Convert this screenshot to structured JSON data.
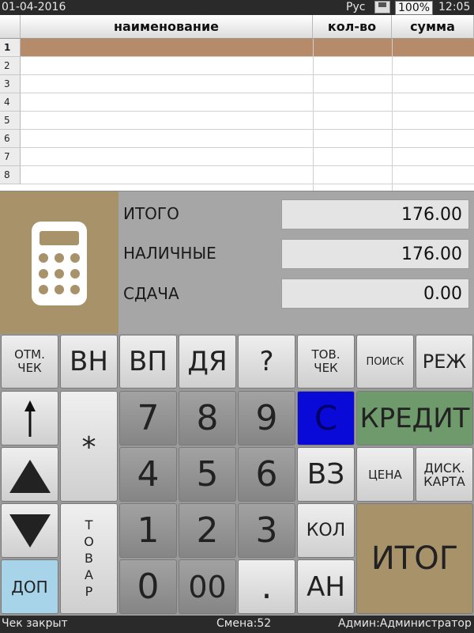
{
  "status": {
    "date": "01-04-2016",
    "lang": "Рус",
    "battery": "100%",
    "time": "12:05"
  },
  "table": {
    "columns": [
      "наименование",
      "кол-во",
      "сумма"
    ],
    "rows": [
      "1",
      "2",
      "3",
      "4",
      "5",
      "6",
      "7",
      "8"
    ]
  },
  "totals": {
    "total_label": "ИТОГО",
    "total_value": "176.00",
    "cash_label": "НАЛИЧНЫЕ",
    "cash_value": "176.00",
    "change_label": "СДАЧА",
    "change_value": "0.00"
  },
  "keys": {
    "cancel_check": "ОТМ. ЧЕК",
    "vn": "ВН",
    "vp": "ВП",
    "dya": "ДЯ",
    "question": "?",
    "goods_check": "ТОВ. ЧЕК",
    "search": "ПОИСК",
    "mode": "РЕЖ",
    "star": "*",
    "n7": "7",
    "n8": "8",
    "n9": "9",
    "clear": "С",
    "credit": "КРЕДИТ",
    "n4": "4",
    "n5": "5",
    "n6": "6",
    "return": "ВЗ",
    "price": "ЦЕНА",
    "disc_card": "ДИСК. КАРТА",
    "goods": "ТОВАР",
    "n1": "1",
    "n2": "2",
    "n3": "3",
    "qty": "КОЛ",
    "itog": "ИТОГ",
    "dop": "ДОП",
    "n0": "0",
    "n00": "00",
    "dot": ".",
    "an": "АН"
  },
  "footer": {
    "check_state": "Чек закрыт",
    "shift": "Смена:52",
    "user": "Админ:Администратор"
  },
  "colors": {
    "selected_row": "#b58b6a",
    "clear_key": "#0a0ad8",
    "credit_key": "#6f9a6c",
    "itog_key": "#a8926a",
    "dop_key": "#a8d4ea"
  }
}
